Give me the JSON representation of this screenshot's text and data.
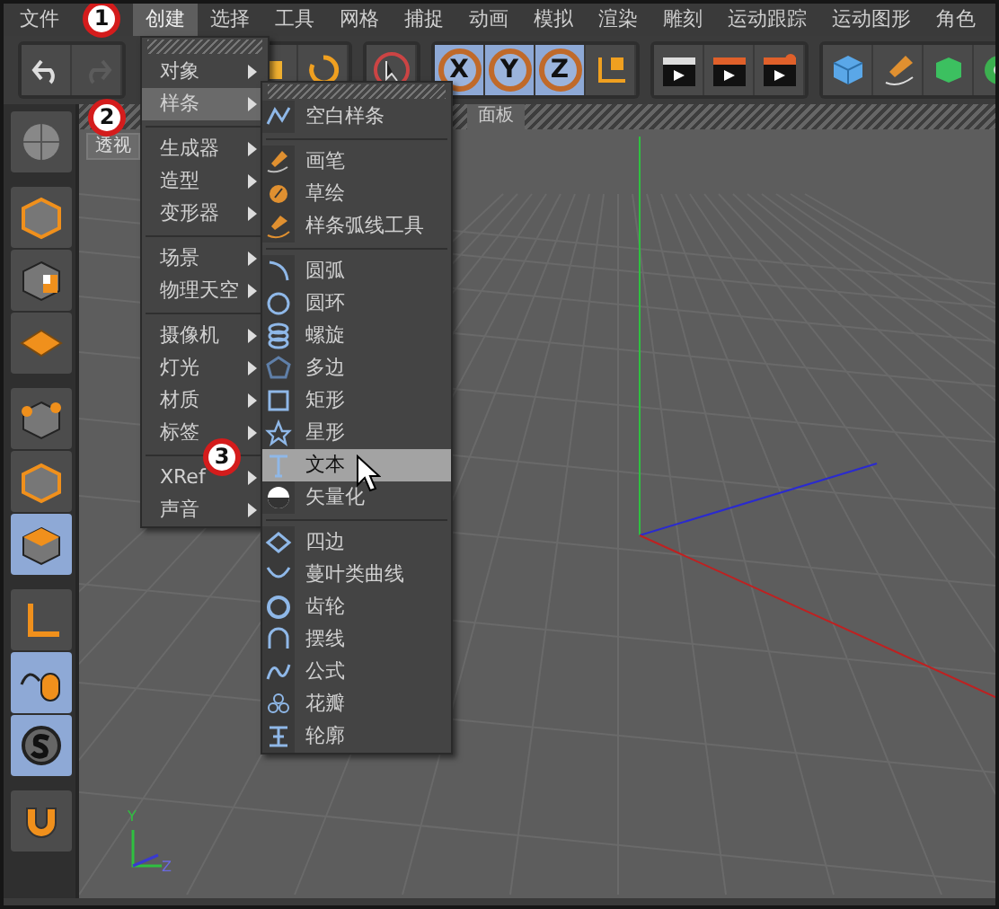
{
  "menubar": {
    "items": [
      {
        "label": "文件",
        "selected": false
      },
      {
        "label": "创建",
        "selected": true
      },
      {
        "label": "选择",
        "selected": false
      },
      {
        "label": "工具",
        "selected": false
      },
      {
        "label": "网格",
        "selected": false
      },
      {
        "label": "捕捉",
        "selected": false
      },
      {
        "label": "动画",
        "selected": false
      },
      {
        "label": "模拟",
        "selected": false
      },
      {
        "label": "渲染",
        "selected": false
      },
      {
        "label": "雕刻",
        "selected": false
      },
      {
        "label": "运动跟踪",
        "selected": false
      },
      {
        "label": "运动图形",
        "selected": false
      },
      {
        "label": "角色",
        "selected": false
      }
    ]
  },
  "toolbar": {
    "undo": {
      "disabled": false
    },
    "redo": {
      "disabled": true
    },
    "axis_lock": [
      {
        "label": "X",
        "selected": true
      },
      {
        "label": "Y",
        "selected": true
      },
      {
        "label": "Z",
        "selected": true
      }
    ]
  },
  "tools": [
    [
      {
        "kind": "globe",
        "selected": false
      }
    ],
    [
      {
        "kind": "cube",
        "selected": false
      },
      {
        "kind": "checker",
        "selected": false
      },
      {
        "kind": "plane",
        "selected": false
      }
    ],
    [
      {
        "kind": "points",
        "selected": false
      },
      {
        "kind": "edges",
        "selected": false
      },
      {
        "kind": "polygons",
        "selected": true
      }
    ],
    [
      {
        "kind": "axis",
        "selected": false
      },
      {
        "kind": "mouse",
        "selected": true
      },
      {
        "kind": "solo",
        "selected": true
      }
    ],
    [
      {
        "kind": "magnet",
        "selected": false
      }
    ]
  ],
  "viewport": {
    "label": "透视",
    "panel_label": "面板",
    "gizmo_labels": [
      "Y",
      "Z"
    ]
  },
  "create_menu": {
    "groups": [
      [
        {
          "label": "对象",
          "submenu": true,
          "selected": false
        },
        {
          "label": "样条",
          "submenu": true,
          "selected": true
        }
      ],
      [
        {
          "label": "生成器",
          "submenu": true,
          "selected": false
        },
        {
          "label": "造型",
          "submenu": true,
          "selected": false
        },
        {
          "label": "变形器",
          "submenu": true,
          "selected": false
        }
      ],
      [
        {
          "label": "场景",
          "submenu": true,
          "selected": false
        },
        {
          "label": "物理天空",
          "submenu": true,
          "selected": false
        }
      ],
      [
        {
          "label": "摄像机",
          "submenu": true,
          "selected": false
        },
        {
          "label": "灯光",
          "submenu": true,
          "selected": false
        },
        {
          "label": "材质",
          "submenu": true,
          "selected": false
        },
        {
          "label": "标签",
          "submenu": true,
          "selected": false
        }
      ],
      [
        {
          "label": "XRef",
          "submenu": true,
          "selected": false
        },
        {
          "label": "声音",
          "submenu": true,
          "selected": false
        }
      ]
    ]
  },
  "spline_menu": {
    "groups": [
      [
        {
          "label": "空白样条",
          "kind": "blank",
          "selected": false
        }
      ],
      [
        {
          "label": "画笔",
          "kind": "pen",
          "selected": false
        },
        {
          "label": "草绘",
          "kind": "sketch",
          "selected": false
        },
        {
          "label": "样条弧线工具",
          "kind": "arctool",
          "selected": false
        }
      ],
      [
        {
          "label": "圆弧",
          "kind": "arc",
          "selected": false
        },
        {
          "label": "圆环",
          "kind": "circle",
          "selected": false
        },
        {
          "label": "螺旋",
          "kind": "helix",
          "selected": false
        },
        {
          "label": "多边",
          "kind": "polygon",
          "selected": false
        },
        {
          "label": "矩形",
          "kind": "rectangle",
          "selected": false
        },
        {
          "label": "星形",
          "kind": "star",
          "selected": false
        },
        {
          "label": "文本",
          "kind": "text",
          "selected": true
        },
        {
          "label": "矢量化",
          "kind": "vectorize",
          "selected": false
        }
      ],
      [
        {
          "label": "四边",
          "kind": "foursided",
          "selected": false
        },
        {
          "label": "蔓叶类曲线",
          "kind": "cissoid",
          "selected": false
        },
        {
          "label": "齿轮",
          "kind": "cog",
          "selected": false
        },
        {
          "label": "摆线",
          "kind": "cycloid",
          "selected": false
        },
        {
          "label": "公式",
          "kind": "formula",
          "selected": false
        },
        {
          "label": "花瓣",
          "kind": "flower",
          "selected": false
        },
        {
          "label": "轮廓",
          "kind": "profile",
          "selected": false
        }
      ]
    ]
  },
  "callouts": [
    "1",
    "2",
    "3"
  ]
}
